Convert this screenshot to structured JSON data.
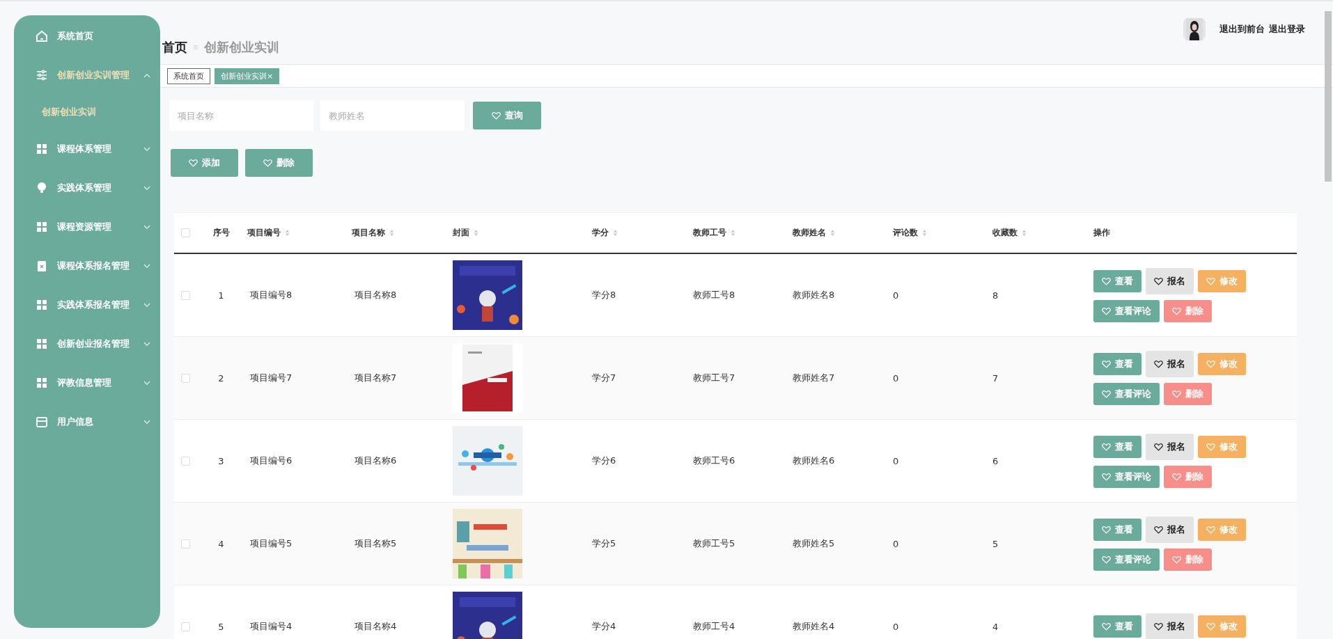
{
  "sidebar": {
    "items": [
      {
        "label": "系统首页",
        "selected": false
      },
      {
        "label": "创新创业实训管理",
        "selected": true,
        "expanded": true,
        "children": [
          {
            "label": "创新创业实训",
            "selected": true
          }
        ]
      },
      {
        "label": "课程体系管理",
        "selected": false,
        "expanded": false
      },
      {
        "label": "实践体系管理",
        "selected": false,
        "expanded": false
      },
      {
        "label": "课程资源管理",
        "selected": false,
        "expanded": false
      },
      {
        "label": "课程体系报名管理",
        "selected": false,
        "expanded": false
      },
      {
        "label": "实践体系报名管理",
        "selected": false,
        "expanded": false
      },
      {
        "label": "创新创业报名管理",
        "selected": false,
        "expanded": false
      },
      {
        "label": "评教信息管理",
        "selected": false,
        "expanded": false
      },
      {
        "label": "用户信息",
        "selected": false,
        "expanded": false
      }
    ]
  },
  "header": {
    "links": [
      "退出到前台",
      "退出登录"
    ]
  },
  "breadcrumb": {
    "home": "首页",
    "current": "创新创业实训"
  },
  "tabs": [
    {
      "label": "系统首页",
      "selected": false
    },
    {
      "label": "创新创业实训",
      "selected": true,
      "close": "×"
    }
  ],
  "search": {
    "fields": [
      {
        "placeholder": "项目名称"
      },
      {
        "placeholder": "教师姓名"
      }
    ],
    "button": "查询"
  },
  "toolbar": {
    "buttons": [
      "添加",
      "删除"
    ]
  },
  "table": {
    "all_checked": false,
    "columns": [
      {
        "label": "序号",
        "sortable": false
      },
      {
        "label": "项目编号",
        "sortable": true
      },
      {
        "label": "项目名称",
        "sortable": true
      },
      {
        "label": "封面",
        "sortable": true
      },
      {
        "label": "学分",
        "sortable": true
      },
      {
        "label": "教师工号",
        "sortable": true
      },
      {
        "label": "教师姓名",
        "sortable": true
      },
      {
        "label": "评论数",
        "sortable": true
      },
      {
        "label": "收藏数",
        "sortable": true
      },
      {
        "label": "操作",
        "sortable": false
      }
    ],
    "rows": [
      {
        "checked": false,
        "cells": [
          "1",
          "项目编号8",
          "项目名称8",
          {
            "kind": "picture"
          },
          "学分8",
          "教师工号8",
          "教师姓名8",
          "0",
          "8"
        ],
        "actions": [
          {
            "label": "查看",
            "kind": "primary"
          },
          {
            "label": "报名",
            "kind": "neutral"
          },
          {
            "label": "修改",
            "kind": "warning"
          },
          {
            "label": "查看评论",
            "kind": "primary"
          },
          {
            "label": "删除",
            "kind": "danger"
          }
        ]
      },
      {
        "checked": false,
        "cells": [
          "2",
          "项目编号7",
          "项目名称7",
          {
            "kind": "picture"
          },
          "学分7",
          "教师工号7",
          "教师姓名7",
          "0",
          "7"
        ],
        "actions": [
          {
            "label": "查看",
            "kind": "primary"
          },
          {
            "label": "报名",
            "kind": "neutral"
          },
          {
            "label": "修改",
            "kind": "warning"
          },
          {
            "label": "查看评论",
            "kind": "primary"
          },
          {
            "label": "删除",
            "kind": "danger"
          }
        ]
      },
      {
        "checked": false,
        "cells": [
          "3",
          "项目编号6",
          "项目名称6",
          {
            "kind": "picture"
          },
          "学分6",
          "教师工号6",
          "教师姓名6",
          "0",
          "6"
        ],
        "actions": [
          {
            "label": "查看",
            "kind": "primary"
          },
          {
            "label": "报名",
            "kind": "neutral"
          },
          {
            "label": "修改",
            "kind": "warning"
          },
          {
            "label": "查看评论",
            "kind": "primary"
          },
          {
            "label": "删除",
            "kind": "danger"
          }
        ]
      },
      {
        "checked": false,
        "cells": [
          "4",
          "项目编号5",
          "项目名称5",
          {
            "kind": "picture"
          },
          "学分5",
          "教师工号5",
          "教师姓名5",
          "0",
          "5"
        ],
        "actions": [
          {
            "label": "查看",
            "kind": "primary"
          },
          {
            "label": "报名",
            "kind": "neutral"
          },
          {
            "label": "修改",
            "kind": "warning"
          },
          {
            "label": "查看评论",
            "kind": "primary"
          },
          {
            "label": "删除",
            "kind": "danger"
          }
        ]
      },
      {
        "checked": false,
        "cells": [
          "5",
          "项目编号4",
          "项目名称4",
          {
            "kind": "picture"
          },
          "学分4",
          "教师工号4",
          "教师姓名4",
          "0",
          "4"
        ],
        "actions": [
          {
            "label": "查看",
            "kind": "primary"
          },
          {
            "label": "报名",
            "kind": "neutral"
          },
          {
            "label": "修改",
            "kind": "warning"
          }
        ]
      }
    ]
  }
}
